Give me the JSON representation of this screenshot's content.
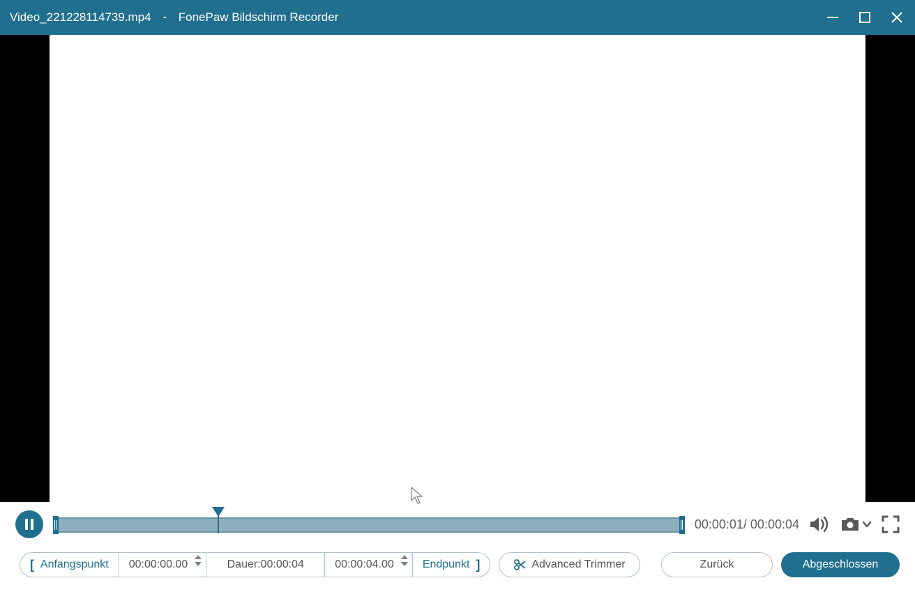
{
  "titlebar": {
    "filename": "Video_221228114739.mp4",
    "separator": "-",
    "app_name": "FonePaw Bildschirm Recorder"
  },
  "playback": {
    "current_time": "00:00:01",
    "sep": "/ ",
    "total_time": "00:00:04"
  },
  "trim": {
    "start_label": "Anfangspunkt",
    "start_time": "00:00:00.00",
    "duration_label": "Dauer:",
    "duration_value": "00:00:04",
    "end_time": "00:00:04.00",
    "end_label": "Endpunkt"
  },
  "buttons": {
    "advanced_trimmer": "Advanced Trimmer",
    "back": "Zurück",
    "done": "Abgeschlossen"
  },
  "icons": {
    "minimize": "minimize-icon",
    "maximize": "maximize-icon",
    "close": "close-icon",
    "pause": "pause-icon",
    "volume": "volume-icon",
    "camera": "camera-icon",
    "chevron": "chevron-down-icon",
    "fullscreen": "fullscreen-icon",
    "scissors": "scissors-icon"
  }
}
